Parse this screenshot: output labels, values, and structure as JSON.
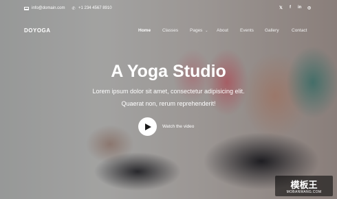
{
  "topbar": {
    "email": "info@domain.com",
    "phone": "+1 234 4567 8910",
    "social": [
      {
        "name": "twitter-icon",
        "glyph": "𝕏"
      },
      {
        "name": "facebook-icon",
        "glyph": "f"
      },
      {
        "name": "linkedin-icon",
        "glyph": "in"
      },
      {
        "name": "instagram-icon",
        "glyph": "◎"
      }
    ]
  },
  "brand": "DOYOGA",
  "nav": [
    "Home",
    "Classes",
    "Pages",
    "About",
    "Events",
    "Gallery",
    "Contact"
  ],
  "hero": {
    "title": "A Yoga Studio",
    "line1": "Lorem ipsum dolor sit amet, consectetur adipisicing elit.",
    "line2": "Quaerat non, rerum reprehenderit!",
    "watch_label": "Watch the video"
  },
  "watermark": {
    "main": "模板王",
    "sub": "MOBANWANG.COM"
  }
}
